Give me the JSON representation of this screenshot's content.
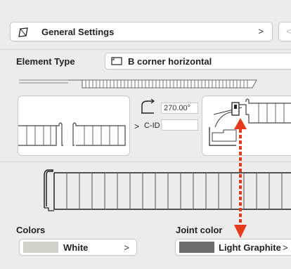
{
  "header": {
    "settings_icon": "rotated-square-icon",
    "title": "General Settings",
    "chevron": ">",
    "nav_button": "<"
  },
  "element_type": {
    "label": "Element Type",
    "value_icon": "corner-profile-icon",
    "value": "B corner horizontal"
  },
  "rotation": {
    "icon": "rotation-angle-icon",
    "angle": "270.00°",
    "cid_label": "C-ID",
    "cid_value": "",
    "arrow": ">"
  },
  "colors": {
    "label": "Colors",
    "swatch": "#d2d0c9",
    "value": "White",
    "chevron": ">"
  },
  "joint_color": {
    "label": "Joint color",
    "swatch": "#6d6d6a",
    "value": "Light Graphite",
    "chevron": ">"
  },
  "annotation": {
    "arrow_color": "#e53a1c"
  }
}
